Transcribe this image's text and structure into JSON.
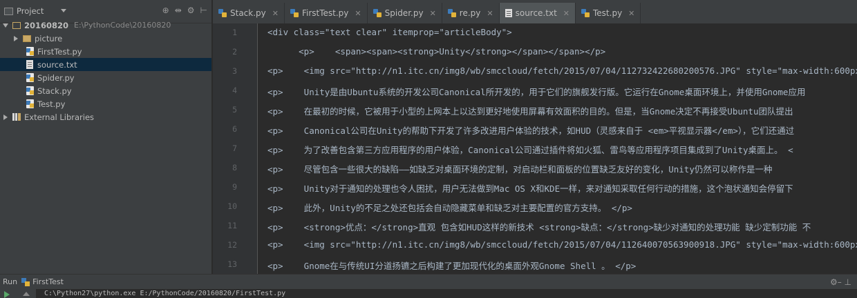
{
  "sidebar": {
    "title": "Project",
    "tools": [
      "⊕",
      "⇹",
      "⚙",
      "⊢"
    ],
    "project": {
      "name": "20160820",
      "path": "E:\\PythonCode\\20160820"
    },
    "items": [
      {
        "label": "picture",
        "kind": "folder"
      },
      {
        "label": "FirstTest.py",
        "kind": "py"
      },
      {
        "label": "source.txt",
        "kind": "txt",
        "selected": true
      },
      {
        "label": "Spider.py",
        "kind": "py"
      },
      {
        "label": "Stack.py",
        "kind": "py"
      },
      {
        "label": "Test.py",
        "kind": "py"
      }
    ],
    "external": "External Libraries"
  },
  "tabs": [
    {
      "label": "Stack.py",
      "kind": "py"
    },
    {
      "label": "FirstTest.py",
      "kind": "py"
    },
    {
      "label": "Spider.py",
      "kind": "py"
    },
    {
      "label": "re.py",
      "kind": "py"
    },
    {
      "label": "source.txt",
      "kind": "txt",
      "active": true
    },
    {
      "label": "Test.py",
      "kind": "py"
    }
  ],
  "editor": {
    "lines": [
      "<div class=\"text clear\" itemprop=\"articleBody\">",
      "      <p>    <span><span><strong>Unity</strong></span></span></p>",
      "<p>    <img src=\"http://n1.itc.cn/img8/wb/smccloud/fetch/2015/07/04/112732422680200576.JPG\" style=\"max-width:600px;\"",
      "<p>    Unity是由Ubuntu系统的开发公司Canonical所开发的，用于它们的旗舰发行版。它运行在Gnome桌面环境上，并使用Gnome应用",
      "<p>    在最初的时候，它被用于小型的上网本上以达到更好地使用屏幕有效面积的目的。但是，当Gnome决定不再接受Ubuntu团队提出",
      "<p>    Canonical公司在Unity的帮助下开发了许多改进用户体验的技术，如HUD（灵感来自于 <em>平视显示器</em>），它们还通过",
      "<p>    为了改善包含第三方应用程序的用户体验，Canonical公司通过插件将如火狐、雷鸟等应用程序项目集成到了Unity桌面上。 <",
      "<p>    尽管包含一些很大的缺陷——如缺乏对桌面环境的定制，对启动栏和面板的位置缺乏友好的变化，Unity仍然可以称作是一种",
      "<p>    Unity对于通知的处理也令人困扰，用户无法做到Mac OS X和KDE一样，来对通知采取任何行动的措施，这个泡状通知会停留下",
      "<p>    此外，Unity的不足之处还包括会自动隐藏菜单和缺乏对主要配置的官方支持。 </p>",
      "<p>    <strong>优点：</strong>直观 包含如HUD这样的新技术 <strong>缺点：</strong>缺少对通知的处理功能 缺少定制功能 不",
      "<p>    <img src=\"http://n1.itc.cn/img8/wb/smccloud/fetch/2015/07/04/112640070563900918.JPG\" style=\"max-width:600px;\"",
      "<p>    Gnome在与传统UI分道扬镳之后构建了更加现代化的桌面外观Gnome Shell 。 </p>"
    ]
  },
  "run": {
    "label": "Run",
    "config": "FirstTest",
    "tools": "⚙– ⊥",
    "command": "C:\\Python27\\python.exe E:/PythonCode/20160820/FirstTest.py"
  }
}
